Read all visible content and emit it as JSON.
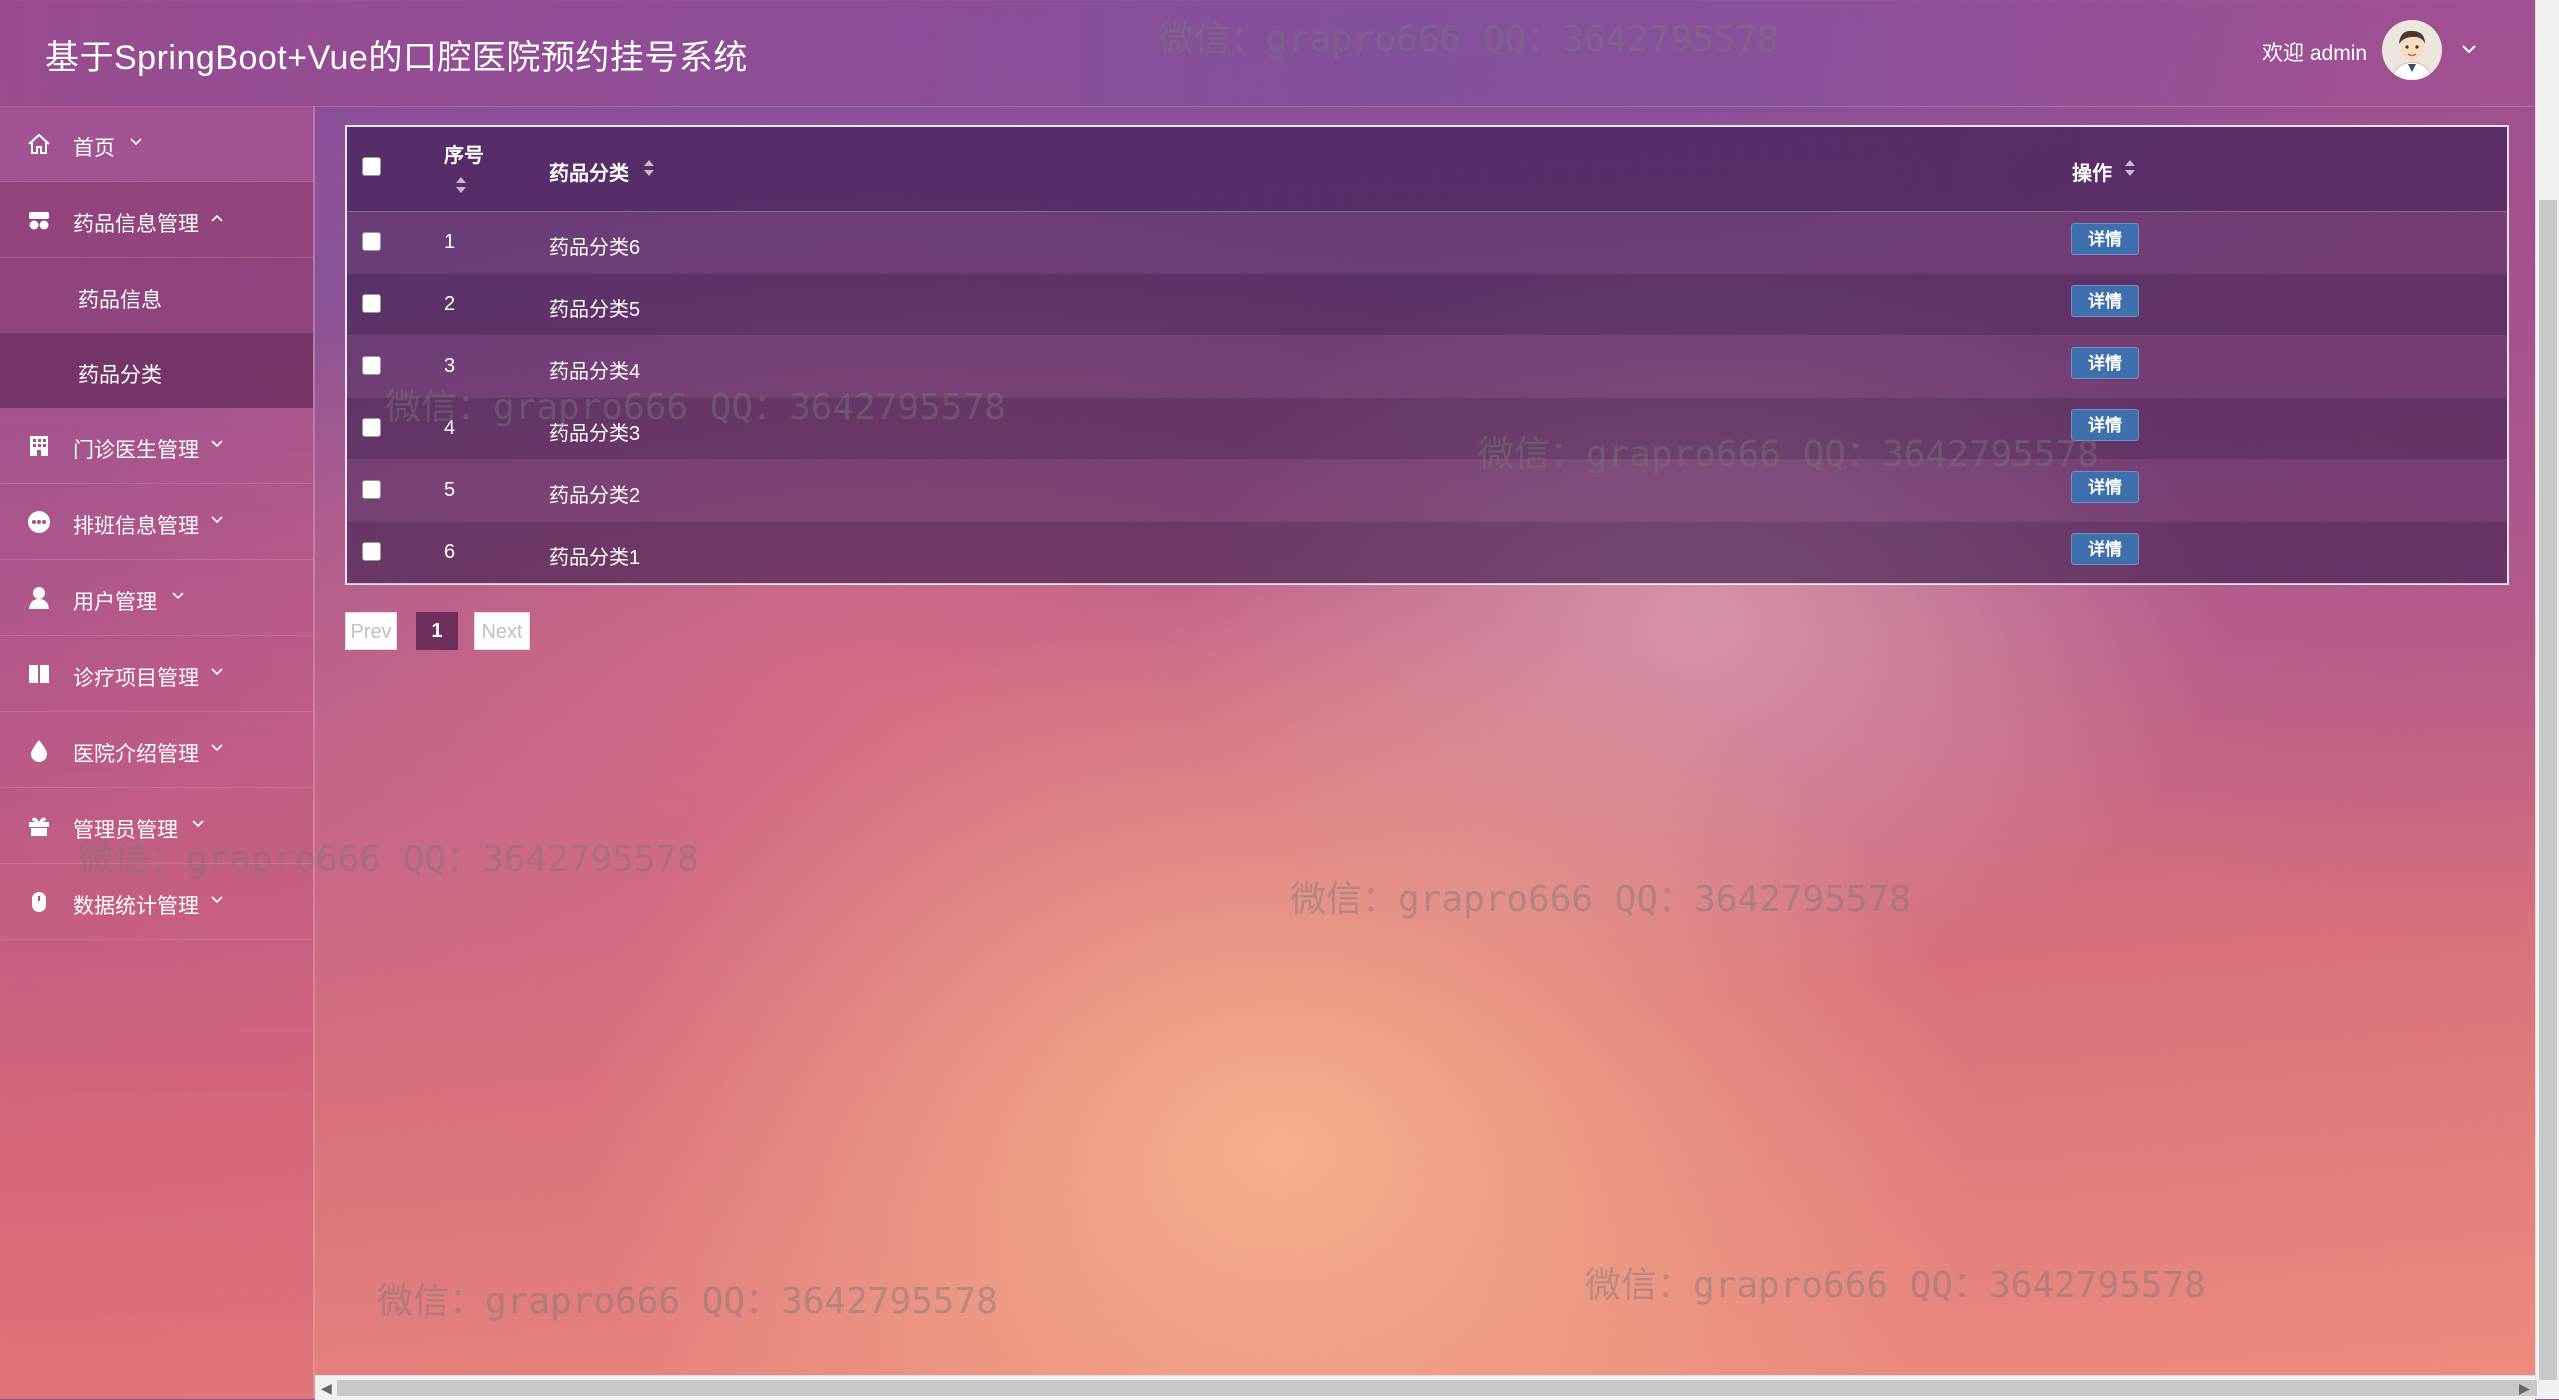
{
  "header": {
    "title": "基于SpringBoot+Vue的口腔医院预约挂号系统",
    "welcome": "欢迎 admin"
  },
  "sidebar": {
    "items": [
      {
        "label": "首页",
        "icon": "home-icon",
        "state": "collapsed"
      },
      {
        "label": "药品信息管理",
        "icon": "medicine-icon",
        "state": "expanded"
      },
      {
        "label": "门诊医生管理",
        "icon": "building-icon",
        "state": "collapsed"
      },
      {
        "label": "排班信息管理",
        "icon": "schedule-icon",
        "state": "collapsed"
      },
      {
        "label": "用户管理",
        "icon": "user-icon",
        "state": "collapsed"
      },
      {
        "label": "诊疗项目管理",
        "icon": "book-icon",
        "state": "collapsed"
      },
      {
        "label": "医院介绍管理",
        "icon": "drop-icon",
        "state": "collapsed"
      },
      {
        "label": "管理员管理",
        "icon": "gift-icon",
        "state": "collapsed"
      },
      {
        "label": "数据统计管理",
        "icon": "mouse-icon",
        "state": "collapsed"
      }
    ],
    "subitems": [
      {
        "label": "药品信息",
        "active": false
      },
      {
        "label": "药品分类",
        "active": true
      }
    ]
  },
  "table": {
    "headers": {
      "index": "序号",
      "category": "药品分类",
      "action": "操作"
    },
    "rows": [
      {
        "index": "1",
        "category": "药品分类6",
        "action": "详情"
      },
      {
        "index": "2",
        "category": "药品分类5",
        "action": "详情"
      },
      {
        "index": "3",
        "category": "药品分类4",
        "action": "详情"
      },
      {
        "index": "4",
        "category": "药品分类3",
        "action": "详情"
      },
      {
        "index": "5",
        "category": "药品分类2",
        "action": "详情"
      },
      {
        "index": "6",
        "category": "药品分类1",
        "action": "详情"
      }
    ]
  },
  "pagination": {
    "prev": "Prev",
    "current": "1",
    "next": "Next"
  },
  "watermark": "微信：grapro666 QQ：3642795578",
  "colors": {
    "detail_button": "#3f6fad",
    "current_page": "#6e2f5d"
  }
}
